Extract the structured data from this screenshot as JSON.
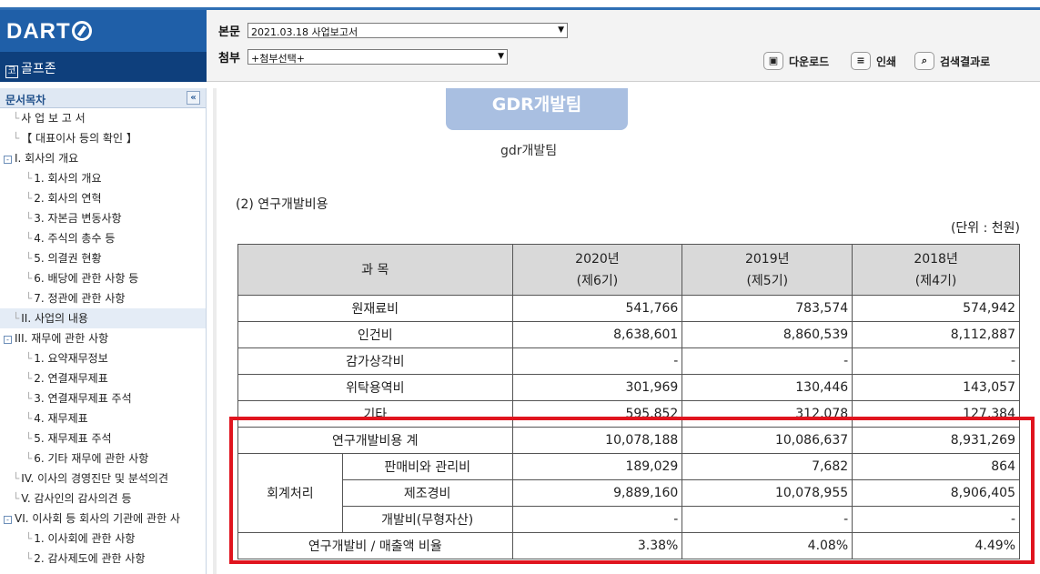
{
  "brand": {
    "logo": "DART",
    "company": "골프존",
    "company_icon": "코"
  },
  "header": {
    "main_label": "본문",
    "main_select": "2021.03.18  사업보고서",
    "attach_label": "첨부",
    "attach_select": "+첨부선택+",
    "download": "다운로드",
    "print": "인쇄",
    "search_results": "검색결과로"
  },
  "sidebar": {
    "title": "문서목차",
    "collapse_glyph": "«",
    "items": [
      {
        "label": "사 업 보 고 서",
        "level": 1
      },
      {
        "label": "【 대표이사 등의 확인 】",
        "level": 1
      },
      {
        "label": "I. 회사의 개요",
        "level": 0,
        "expander": "-"
      },
      {
        "label": "1. 회사의 개요",
        "level": 2
      },
      {
        "label": "2. 회사의 연혁",
        "level": 2
      },
      {
        "label": "3. 자본금 변동사항",
        "level": 2
      },
      {
        "label": "4. 주식의 총수 등",
        "level": 2
      },
      {
        "label": "5. 의결권 현황",
        "level": 2
      },
      {
        "label": "6. 배당에 관한 사항 등",
        "level": 2
      },
      {
        "label": "7. 정관에 관한 사항",
        "level": 2
      },
      {
        "label": "II. 사업의 내용",
        "level": 1,
        "selected": true
      },
      {
        "label": "III. 재무에 관한 사항",
        "level": 0,
        "expander": "-"
      },
      {
        "label": "1. 요약재무정보",
        "level": 2
      },
      {
        "label": "2. 연결재무제표",
        "level": 2
      },
      {
        "label": "3. 연결재무제표 주석",
        "level": 2
      },
      {
        "label": "4. 재무제표",
        "level": 2
      },
      {
        "label": "5. 재무제표 주석",
        "level": 2
      },
      {
        "label": "6. 기타 재무에 관한 사항",
        "level": 2
      },
      {
        "label": "IV. 이사의 경영진단 및 분석의견",
        "level": 1
      },
      {
        "label": "V. 감사인의 감사의견 등",
        "level": 1
      },
      {
        "label": "VI. 이사회 등 회사의 기관에 관한 사",
        "level": 0,
        "expander": "-"
      },
      {
        "label": "1. 이사회에 관한 사항",
        "level": 2
      },
      {
        "label": "2. 감사제도에 관한 사항",
        "level": 2
      }
    ]
  },
  "content": {
    "banner": "GDR개발팀",
    "caption": "gdr개발팀",
    "section_title": "(2) 연구개발비용",
    "unit": "(단위 : 천원)",
    "table": {
      "headers": [
        {
          "line1": "과 목",
          "line2": ""
        },
        {
          "line1": "2020년",
          "line2": "(제6기)"
        },
        {
          "line1": "2019년",
          "line2": "(제5기)"
        },
        {
          "line1": "2018년",
          "line2": "(제4기)"
        }
      ],
      "rows": [
        {
          "label": "원재료비",
          "v2020": "541,766",
          "v2019": "783,574",
          "v2018": "574,942"
        },
        {
          "label": "인건비",
          "v2020": "8,638,601",
          "v2019": "8,860,539",
          "v2018": "8,112,887"
        },
        {
          "label": "감가상각비",
          "v2020": "-",
          "v2019": "-",
          "v2018": "-"
        },
        {
          "label": "위탁용역비",
          "v2020": "301,969",
          "v2019": "130,446",
          "v2018": "143,057"
        },
        {
          "label": "기타",
          "v2020": "595,852",
          "v2019": "312,078",
          "v2018": "127,384"
        },
        {
          "label": "연구개발비용 계",
          "v2020": "10,078,188",
          "v2019": "10,086,637",
          "v2018": "8,931,269"
        }
      ],
      "accounting_group": "회계처리",
      "accounting_rows": [
        {
          "label": "판매비와 관리비",
          "v2020": "189,029",
          "v2019": "7,682",
          "v2018": "864"
        },
        {
          "label": "제조경비",
          "v2020": "9,889,160",
          "v2019": "10,078,955",
          "v2018": "8,906,405"
        },
        {
          "label": "개발비(무형자산)",
          "v2020": "-",
          "v2019": "-",
          "v2018": "-"
        }
      ],
      "ratio_row": {
        "label": "연구개발비 / 매출액 비율",
        "v2020": "3.38%",
        "v2019": "4.08%",
        "v2018": "4.49%"
      }
    },
    "highlight_color": "#e0141e"
  }
}
